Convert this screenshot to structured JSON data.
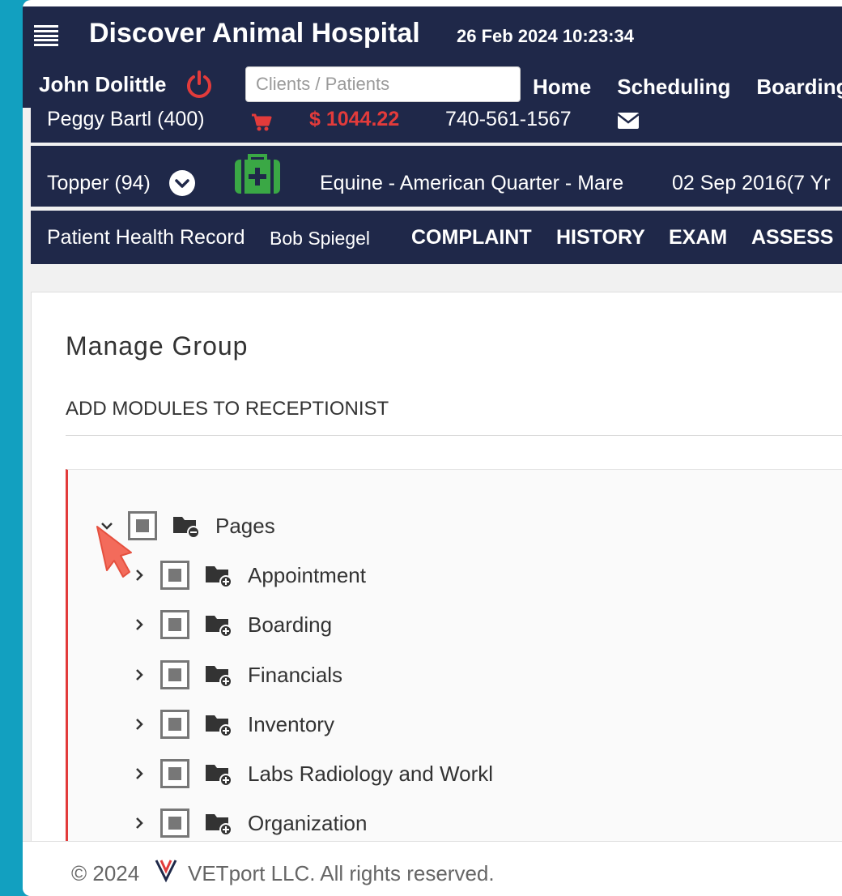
{
  "header": {
    "app_title": "Discover Animal Hospital",
    "datetime": "26 Feb 2024 10:23:34",
    "user_name": "John Dolittle",
    "search_placeholder": "Clients / Patients",
    "nav": [
      "Home",
      "Scheduling",
      "Boarding"
    ]
  },
  "client": {
    "name": "Peggy Bartl (400)",
    "balance": "$ 1044.22",
    "phone": "740-561-1567"
  },
  "patient": {
    "name": "Topper (94)",
    "description": "Equine - American Quarter - Mare",
    "birth": "02 Sep 2016(7 Yr"
  },
  "record": {
    "title": "Patient Health Record",
    "doctor": "Bob Spiegel",
    "tabs": [
      "COMPLAINT",
      "HISTORY",
      "EXAM",
      "ASSESS"
    ]
  },
  "manage": {
    "title": "Manage Group",
    "subtitle": "ADD MODULES TO RECEPTIONIST",
    "root": "Pages",
    "children": [
      "Appointment",
      "Boarding",
      "Financials",
      "Inventory",
      "Labs Radiology and Workl",
      "Organization"
    ]
  },
  "footer": {
    "copyright": "© 2024",
    "company": "VETport LLC. All rights reserved."
  },
  "colors": {
    "navy": "#1f2849",
    "red": "#e23b3b",
    "green": "#3aa845",
    "teal": "#12a0c0"
  }
}
